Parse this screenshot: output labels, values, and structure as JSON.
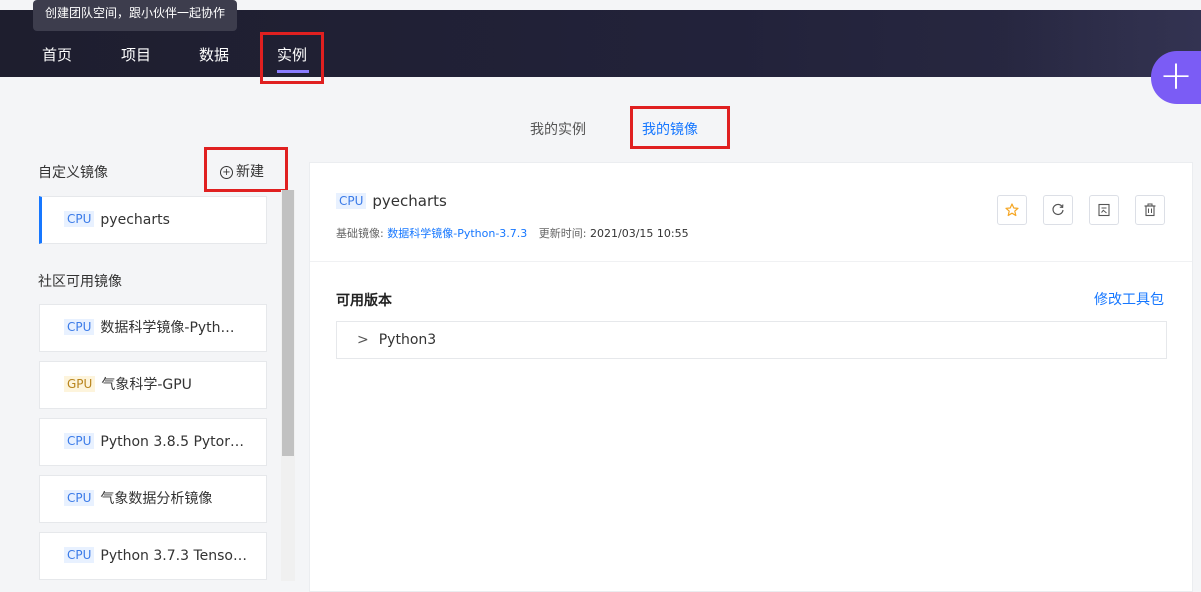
{
  "tooltip": "创建团队空间，跟小伙伴一起协作",
  "nav": {
    "home": "首页",
    "projects": "项目",
    "data": "数据",
    "instances": "实例"
  },
  "subtabs": {
    "my_instances": "我的实例",
    "my_images": "我的镜像"
  },
  "sidebar": {
    "custom_title": "自定义镜像",
    "new_label": "新建",
    "custom_items": [
      {
        "tag": "CPU",
        "name": "pyecharts"
      }
    ],
    "community_title": "社区可用镜像",
    "community_items": [
      {
        "tag": "CPU",
        "name": "数据科学镜像-Pyth…"
      },
      {
        "tag": "GPU",
        "name": "气象科学-GPU"
      },
      {
        "tag": "CPU",
        "name": "Python 3.8.5 Pytor…"
      },
      {
        "tag": "CPU",
        "name": "气象数据分析镜像"
      },
      {
        "tag": "CPU",
        "name": "Python 3.7.3 Tenso…"
      }
    ]
  },
  "detail": {
    "tag": "CPU",
    "name": "pyecharts",
    "base_label": "基础镜像:",
    "base_value": "数据科学镜像-Python-3.7.3",
    "updated_label": "更新时间:",
    "updated_value": "2021/03/15 10:55",
    "versions_title": "可用版本",
    "modify_link": "修改工具包",
    "versions": [
      "Python3"
    ]
  },
  "actions": [
    "star-icon",
    "refresh-icon",
    "edit-icon",
    "delete-icon"
  ],
  "colors": {
    "accent": "#1677ff",
    "fab": "#7b5cf5",
    "highlight": "#e02020",
    "nav_bg": "#1e1e2e",
    "star": "#f5a623"
  }
}
